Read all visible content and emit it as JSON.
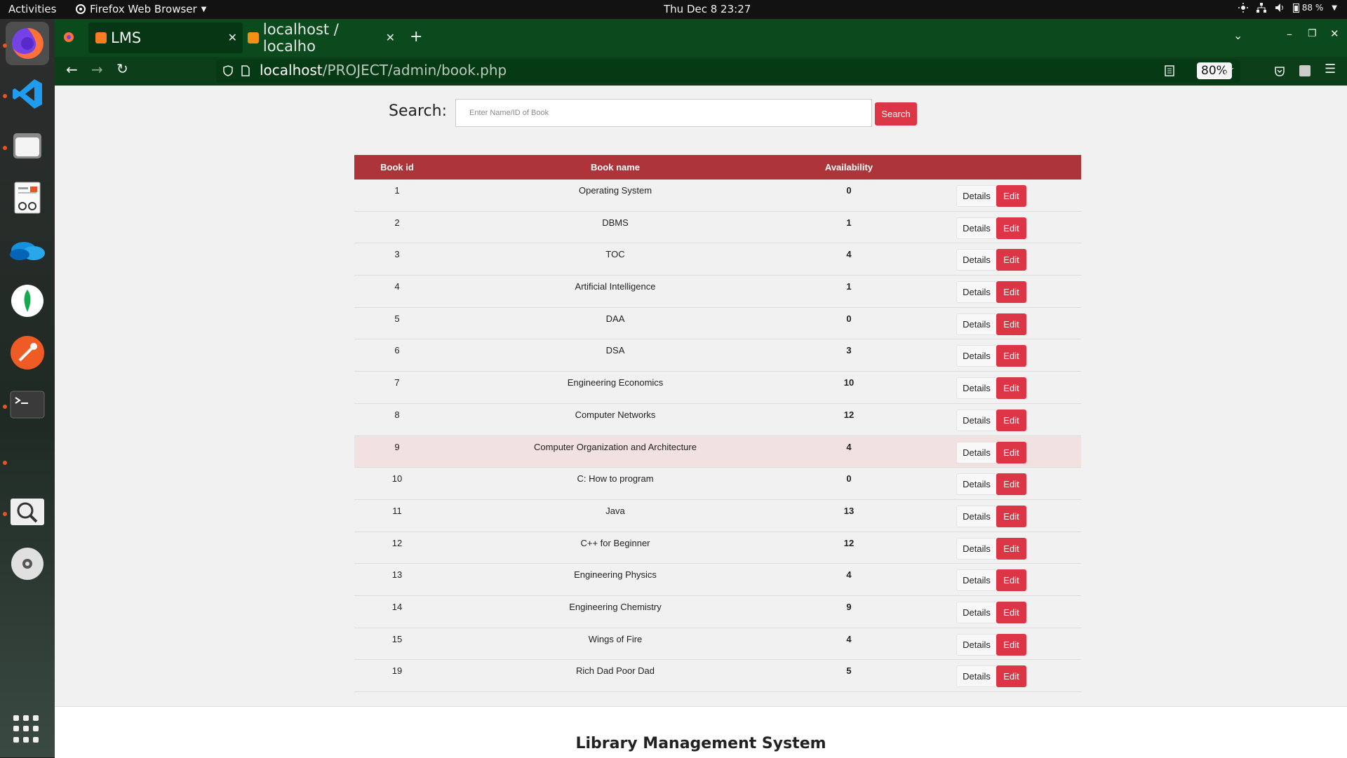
{
  "topbar": {
    "activities": "Activities",
    "app_name": "Firefox Web Browser",
    "clock": "Thu Dec 8  23:27",
    "battery": "88 %"
  },
  "dock": {
    "items": [
      "firefox-icon",
      "vscode-icon",
      "files-icon",
      "document-viewer-icon",
      "onedrive-icon",
      "mongodb-compass-icon",
      "postman-icon",
      "terminal-icon",
      "image-viewer-icon",
      "disc-icon"
    ]
  },
  "browser": {
    "tabs": [
      {
        "label": "LMS",
        "active": true
      },
      {
        "label": "localhost / localho",
        "active": false
      }
    ],
    "url_host": "localhost",
    "url_path": "/PROJECT/admin/book.php",
    "zoom": "80%"
  },
  "search": {
    "label": "Search:",
    "placeholder": "Enter Name/ID of Book",
    "button": "Search"
  },
  "table": {
    "headers": [
      "Book id",
      "Book name",
      "Availability"
    ],
    "details_label": "Details",
    "edit_label": "Edit",
    "rows": [
      {
        "id": "1",
        "name": "Operating System",
        "availability": "0"
      },
      {
        "id": "2",
        "name": "DBMS",
        "availability": "1"
      },
      {
        "id": "3",
        "name": "TOC",
        "availability": "4"
      },
      {
        "id": "4",
        "name": "Artificial Intelligence",
        "availability": "1"
      },
      {
        "id": "5",
        "name": "DAA",
        "availability": "0"
      },
      {
        "id": "6",
        "name": "DSA",
        "availability": "3"
      },
      {
        "id": "7",
        "name": "Engineering Economics",
        "availability": "10"
      },
      {
        "id": "8",
        "name": "Computer Networks",
        "availability": "12"
      },
      {
        "id": "9",
        "name": "Computer Organization and Architecture",
        "availability": "4",
        "highlighted": true
      },
      {
        "id": "10",
        "name": "C: How to program",
        "availability": "0"
      },
      {
        "id": "11",
        "name": "Java",
        "availability": "13"
      },
      {
        "id": "12",
        "name": "C++ for Beginner",
        "availability": "12"
      },
      {
        "id": "13",
        "name": "Engineering Physics",
        "availability": "4"
      },
      {
        "id": "14",
        "name": "Engineering Chemistry",
        "availability": "9"
      },
      {
        "id": "15",
        "name": "Wings of Fire",
        "availability": "4"
      },
      {
        "id": "19",
        "name": "Rich Dad Poor Dad",
        "availability": "5"
      }
    ]
  },
  "footer": {
    "title": "Library Management System"
  },
  "colors": {
    "header_red": "#ad3438",
    "button_red": "#dc3545",
    "firefox_toolbar": "#0a4a1c"
  }
}
